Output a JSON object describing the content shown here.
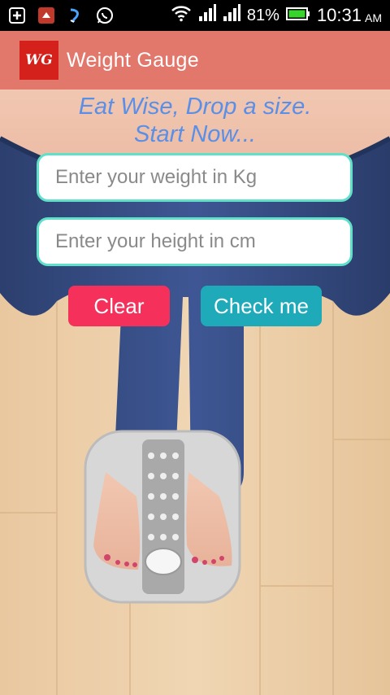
{
  "status_bar": {
    "battery_percent": "81%",
    "time": "10:31",
    "ampm": "AM"
  },
  "app_bar": {
    "logo_text": "WG",
    "title": "Weight Gauge"
  },
  "main": {
    "slogan_line1": "Eat Wise, Drop a size.",
    "slogan_line2": "Start Now...",
    "weight_placeholder": "Enter your weight in Kg",
    "height_placeholder": "Enter your height in cm",
    "clear_label": "Clear",
    "check_label": "Check me"
  },
  "colors": {
    "app_bar": "#e2776c",
    "slogan": "#5a8fe8",
    "input_border": "#5fe0c8",
    "clear_button": "#f5305b",
    "check_button": "#1faab9"
  }
}
